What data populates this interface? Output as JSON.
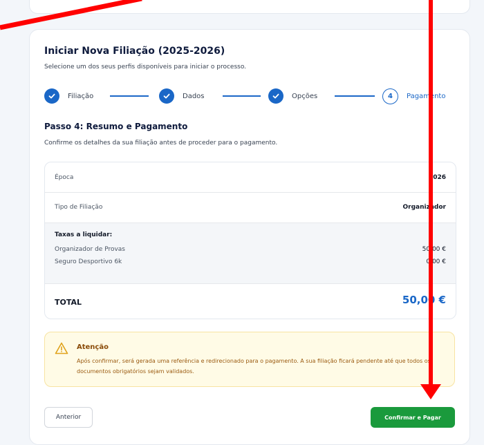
{
  "header": {
    "title": "Iniciar Nova Filiação (2025-2026)",
    "subtitle": "Selecione um dos seus perfis disponíveis para iniciar o processo."
  },
  "stepper": {
    "steps": [
      {
        "label": "Filiação",
        "state": "completed"
      },
      {
        "label": "Dados",
        "state": "completed"
      },
      {
        "label": "Opções",
        "state": "completed"
      },
      {
        "label": "Pagamento",
        "state": "active",
        "number": "4"
      }
    ]
  },
  "step": {
    "heading": "Passo 4: Resumo e Pagamento",
    "description": "Confirme os detalhes da sua filiação antes de proceder para o pagamento."
  },
  "summary": {
    "epoca_label": "Época",
    "epoca_value": "2026",
    "tipo_label": "Tipo de Filiação",
    "tipo_value": "Organizador",
    "fees_title": "Taxas a liquidar:",
    "fees": [
      {
        "label": "Organizador de Provas",
        "value": "50,00 €"
      },
      {
        "label": "Seguro Desportivo 6k",
        "value": "0,00 €"
      }
    ],
    "total_label": "TOTAL",
    "total_value": "50,00 €"
  },
  "alert": {
    "title": "Atenção",
    "text": "Após confirmar, será gerada uma referência e redirecionado para o pagamento. A sua filiação ficará pendente até que todos os documentos obrigatórios sejam validados."
  },
  "actions": {
    "previous_label": "Anterior",
    "confirm_label": "Confirmar e Pagar"
  },
  "colors": {
    "accent": "#1a67c7",
    "confirm": "#1a9a3c",
    "annotation": "#ff0000"
  }
}
